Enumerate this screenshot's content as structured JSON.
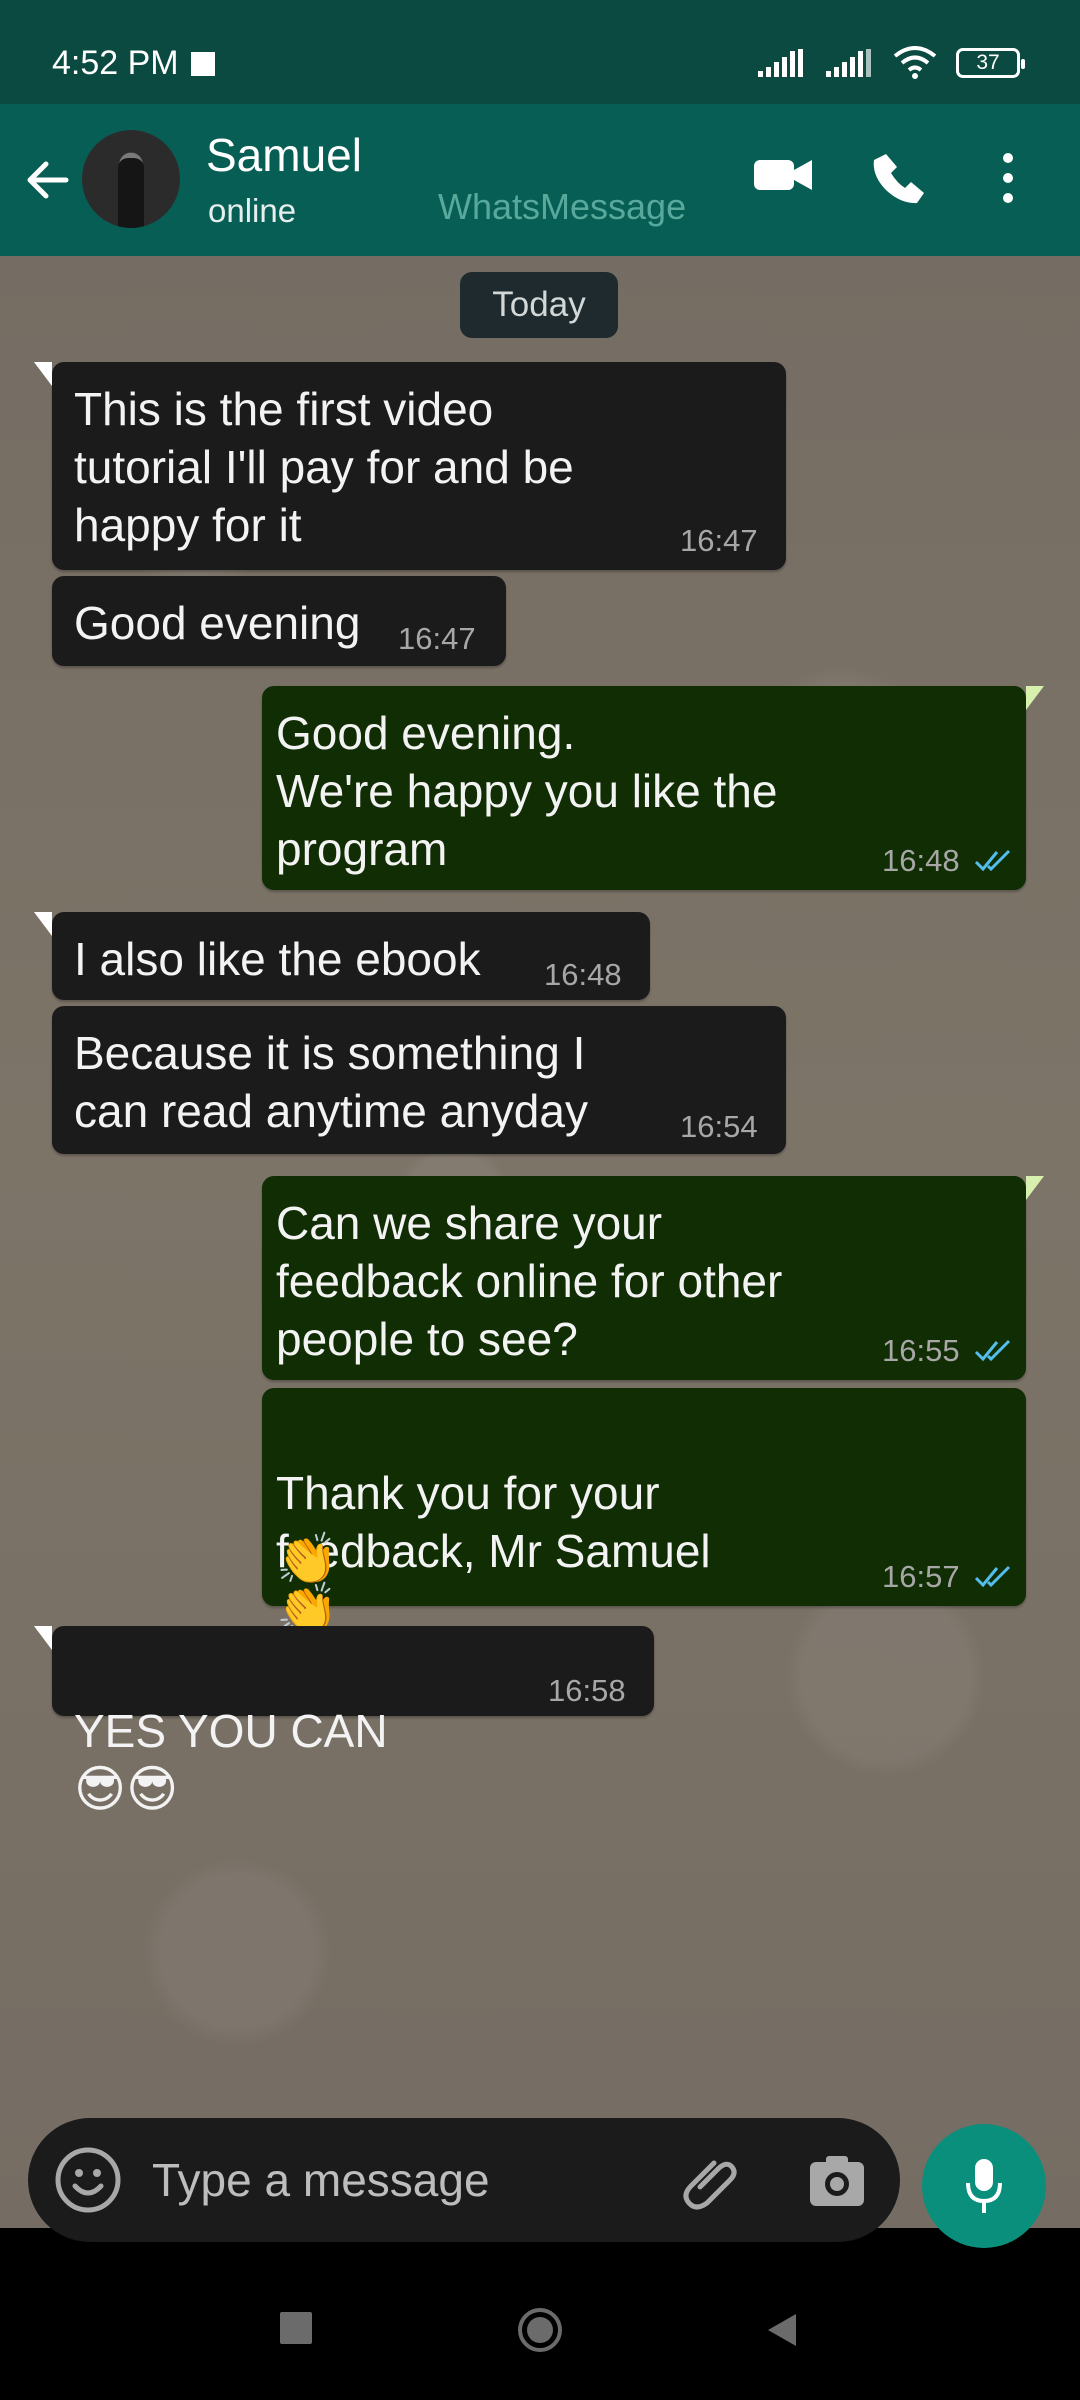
{
  "status_bar": {
    "time": "4:52 PM",
    "battery": "37",
    "icons": [
      "notification-square-icon",
      "signal-icon",
      "signal-icon",
      "wifi-icon",
      "battery-icon"
    ]
  },
  "header": {
    "contact_name": "Samuel",
    "contact_status": "online",
    "watermark": "WhatsMessage",
    "icons": [
      "back-arrow-icon",
      "video-call-icon",
      "phone-icon",
      "more-vertical-icon"
    ]
  },
  "chat": {
    "date_label": "Today",
    "messages": [
      {
        "direction": "incoming",
        "text": "This is the first video\ntutorial I'll pay for and be\nhappy for it",
        "time": "16:47"
      },
      {
        "direction": "incoming",
        "text": "Good evening",
        "time": "16:47"
      },
      {
        "direction": "outgoing",
        "text": "Good evening.\nWe're happy you like the\nprogram",
        "time": "16:48",
        "status": "read"
      },
      {
        "direction": "incoming",
        "text": "I also like the ebook",
        "time": "16:48"
      },
      {
        "direction": "incoming",
        "text": "Because it is something I\ncan read anytime anyday",
        "time": "16:54"
      },
      {
        "direction": "outgoing",
        "text": "Can we share your\nfeedback online for other\npeople to see?",
        "time": "16:55",
        "status": "read"
      },
      {
        "direction": "outgoing",
        "text": "Thank you for your\nfeedback, Mr Samuel",
        "emoji_inline": "👏",
        "emoji_next_line": "👏",
        "time": "16:57",
        "status": "read"
      },
      {
        "direction": "incoming",
        "text": "YES YOU CAN",
        "emoji": "😎😎",
        "time": "16:58"
      }
    ]
  },
  "composer": {
    "placeholder": "Type a message",
    "icons": [
      "emoji-icon",
      "attachment-icon",
      "camera-icon",
      "microphone-icon"
    ]
  },
  "navigation": {
    "icons": [
      "recent-apps-icon",
      "home-icon",
      "back-icon"
    ]
  },
  "colors": {
    "status_bar": "#0a4a40",
    "header": "#075e54",
    "incoming_bubble": "#1b1b1b",
    "outgoing_bubble": "#102d03",
    "read_ticks": "#53bdeb",
    "mic_button": "#0a8f7d"
  }
}
